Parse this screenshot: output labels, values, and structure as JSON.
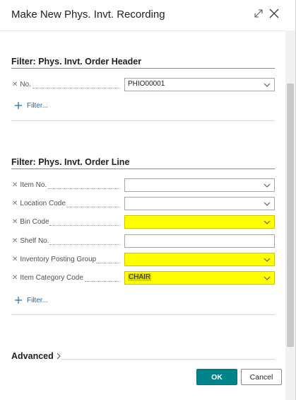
{
  "dialog": {
    "title": "Make New Phys. Invt. Recording"
  },
  "header_filter": {
    "title": "Filter: Phys. Invt. Order Header",
    "fields": [
      {
        "label": "No.",
        "value": "PHIO00001",
        "highlighted": false
      }
    ],
    "add_filter_label": "Filter..."
  },
  "line_filter": {
    "title": "Filter: Phys. Invt. Order Line",
    "fields": [
      {
        "label": "Item No.",
        "value": "",
        "highlighted": false
      },
      {
        "label": "Location Code",
        "value": "",
        "highlighted": false
      },
      {
        "label": "Bin Code",
        "value": "",
        "highlighted": true
      },
      {
        "label": "Shelf No.",
        "value": "",
        "highlighted": false
      },
      {
        "label": "Inventory Posting Group",
        "value": "",
        "highlighted": true
      },
      {
        "label": "Item Category Code",
        "value": "CHAIR",
        "highlighted": true
      }
    ],
    "add_filter_label": "Filter..."
  },
  "advanced": {
    "label": "Advanced"
  },
  "footer": {
    "ok_label": "OK",
    "cancel_label": "Cancel"
  },
  "colors": {
    "accent": "#008489",
    "link": "#1f6aa5",
    "highlight": "#ffff00"
  },
  "icons": {
    "expand": "expand-icon",
    "close": "close-icon",
    "remove_filter": "remove-filter-icon",
    "dropdown": "chevron-down-icon",
    "add": "plus-icon",
    "advanced": "chevron-right-icon"
  }
}
